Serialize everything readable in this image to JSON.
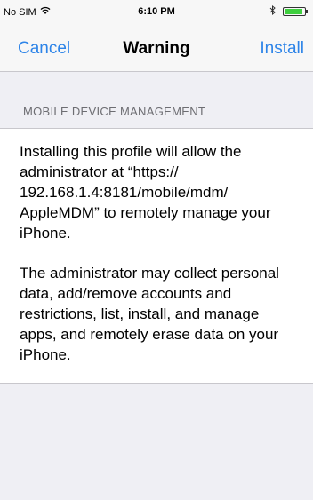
{
  "status_bar": {
    "carrier": "No SIM",
    "wifi_icon": "wifi-icon",
    "time": "6:10 PM",
    "bluetooth_icon": "bluetooth-icon",
    "battery_icon": "battery-icon",
    "battery_color": "#3fcf3f",
    "battery_level": 0.9
  },
  "nav_bar": {
    "cancel_label": "Cancel",
    "title": "Warning",
    "install_label": "Install",
    "accent_color": "#2d84e8"
  },
  "section": {
    "header": "MOBILE DEVICE MANAGEMENT",
    "paragraphs": [
      "Installing this profile will allow the\nadministrator at “https://\n192.168.1.4:8181/mobile/mdm/\nAppleMDM” to remotely manage your\niPhone.",
      "The administrator may collect personal\ndata, add/remove accounts and\nrestrictions, list, install, and manage\napps, and remotely erase data on your\niPhone."
    ]
  }
}
